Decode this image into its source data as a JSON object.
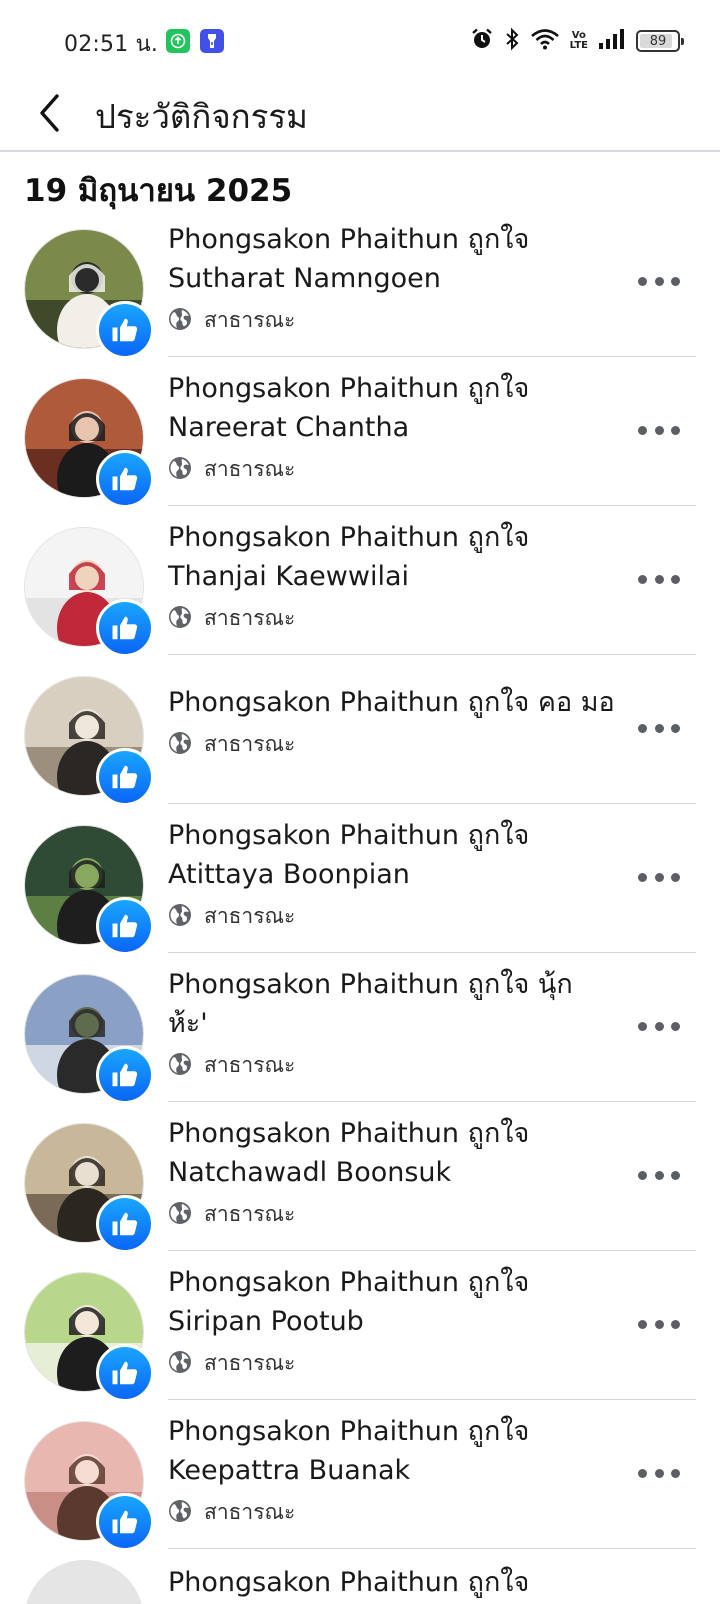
{
  "status_bar": {
    "time": "02:51 น.",
    "battery": "89",
    "battery_level": 0.89,
    "icons": [
      "green-app-icon",
      "flashlight-app-icon",
      "alarm-icon",
      "bluetooth-icon",
      "wifi-icon",
      "volte-icon",
      "signal-icon",
      "battery-icon"
    ],
    "volte_top": "Vo",
    "volte_bottom": "LTE"
  },
  "header": {
    "title": "ประวัติกิจกรรม",
    "back_icon": "chevron-left-icon"
  },
  "date_heading": "19 มิถุนายน 2025",
  "privacy_label": "สาธารณะ",
  "accent_color": "#1877F2",
  "activities": [
    {
      "line1": "Phongsakon Phaithun ถูกใจ",
      "line2": "Sutharat Namngoen",
      "privacy": "สาธารณะ"
    },
    {
      "line1": "Phongsakon Phaithun ถูกใจ",
      "line2": "Nareerat Chantha",
      "privacy": "สาธารณะ"
    },
    {
      "line1": "Phongsakon Phaithun ถูกใจ",
      "line2": "Thanjai Kaewwilai",
      "privacy": "สาธารณะ"
    },
    {
      "line1": "Phongsakon Phaithun ถูกใจ คอ มอ",
      "line2": "",
      "privacy": "สาธารณะ"
    },
    {
      "line1": "Phongsakon Phaithun ถูกใจ",
      "line2": "Atittaya Boonpian",
      "privacy": "สาธารณะ"
    },
    {
      "line1": "Phongsakon Phaithun ถูกใจ นุ้ก",
      "line2": "ห้ะ'",
      "privacy": "สาธารณะ"
    },
    {
      "line1": "Phongsakon Phaithun ถูกใจ",
      "line2": "Natchawadl Boonsuk",
      "privacy": "สาธารณะ"
    },
    {
      "line1": "Phongsakon Phaithun ถูกใจ",
      "line2": "Siripan Pootub",
      "privacy": "สาธารณะ"
    },
    {
      "line1": "Phongsakon Phaithun ถูกใจ",
      "line2": "Keepattra Buanak",
      "privacy": "สาธารณะ"
    }
  ],
  "peek_text": "Phongsakon Phaithun ถูกใจ"
}
